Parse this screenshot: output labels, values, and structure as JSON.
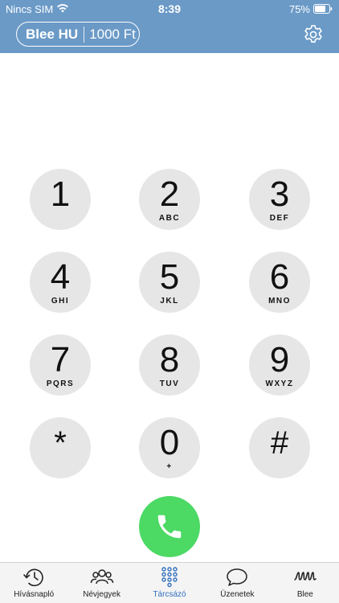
{
  "status_bar": {
    "carrier": "Nincs SIM",
    "time": "8:39",
    "battery": "75%"
  },
  "account": {
    "name": "Blee HU",
    "balance": "1000 Ft"
  },
  "keys": [
    {
      "digit": "1",
      "letters": ""
    },
    {
      "digit": "2",
      "letters": "ABC"
    },
    {
      "digit": "3",
      "letters": "DEF"
    },
    {
      "digit": "4",
      "letters": "GHI"
    },
    {
      "digit": "5",
      "letters": "JKL"
    },
    {
      "digit": "6",
      "letters": "MNO"
    },
    {
      "digit": "7",
      "letters": "PQRS"
    },
    {
      "digit": "8",
      "letters": "TUV"
    },
    {
      "digit": "9",
      "letters": "WXYZ"
    },
    {
      "digit": "*",
      "letters": ""
    },
    {
      "digit": "0",
      "letters": "+"
    },
    {
      "digit": "#",
      "letters": ""
    }
  ],
  "tabs": [
    {
      "label": "Hívásnapló",
      "icon": "history-icon",
      "active": false
    },
    {
      "label": "Névjegyek",
      "icon": "contacts-icon",
      "active": false
    },
    {
      "label": "Tárcsázó",
      "icon": "keypad-icon",
      "active": true
    },
    {
      "label": "Üzenetek",
      "icon": "message-icon",
      "active": false
    },
    {
      "label": "Blee",
      "icon": "blee-logo-icon",
      "active": false
    }
  ],
  "colors": {
    "header": "#6b9ac7",
    "key": "#e6e6e6",
    "call": "#4cd964",
    "tab_active": "#2f6fbe"
  }
}
